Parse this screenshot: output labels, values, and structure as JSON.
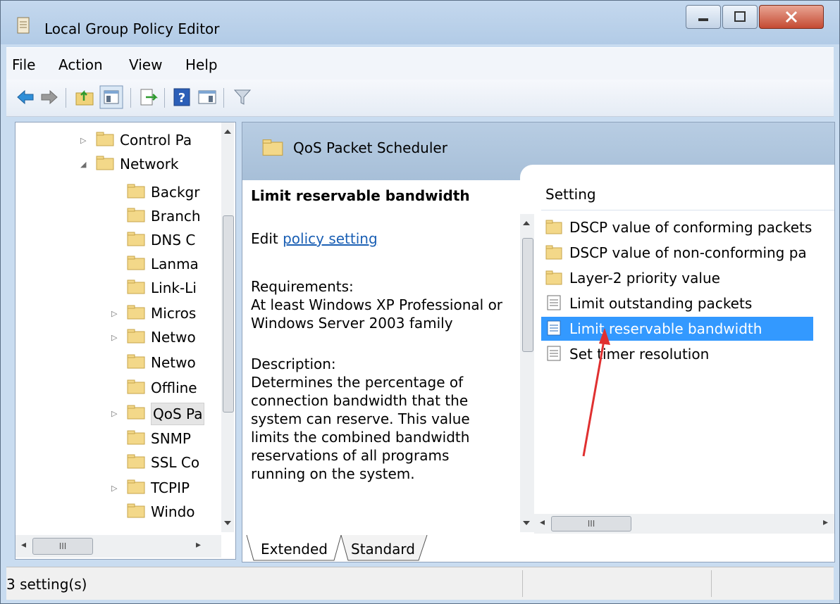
{
  "window": {
    "title": "Local Group Policy Editor"
  },
  "menu": [
    {
      "label": "File"
    },
    {
      "label": "Action"
    },
    {
      "label": "View"
    },
    {
      "label": "Help"
    }
  ],
  "toolbar": {
    "buttons": [
      "back-icon",
      "forward-icon",
      "up-folder-icon",
      "show-hide-console-tree-icon",
      "export-list-icon",
      "help-icon",
      "show-hide-action-pane-icon",
      "filter-icon"
    ]
  },
  "tree": {
    "items": [
      {
        "label": "Control Pa",
        "expander": "▷"
      },
      {
        "label": "Network",
        "expander": "◢"
      },
      {
        "label": "Backgr",
        "expander": ""
      },
      {
        "label": "Branch",
        "expander": ""
      },
      {
        "label": "DNS C",
        "expander": ""
      },
      {
        "label": "Lanma",
        "expander": ""
      },
      {
        "label": "Link-Li",
        "expander": ""
      },
      {
        "label": "Micros",
        "expander": "▷"
      },
      {
        "label": "Netwo",
        "expander": "▷"
      },
      {
        "label": "Netwo",
        "expander": ""
      },
      {
        "label": "Offline",
        "expander": ""
      },
      {
        "label": "QoS Pa",
        "expander": "▷"
      },
      {
        "label": "SNMP",
        "expander": ""
      },
      {
        "label": "SSL Co",
        "expander": ""
      },
      {
        "label": "TCPIP",
        "expander": "▷"
      },
      {
        "label": "Windo",
        "expander": ""
      }
    ],
    "scroll_h_thumb": "III"
  },
  "right": {
    "header_title": "QoS Packet Scheduler",
    "extended": {
      "selected_name": "Limit reservable bandwidth",
      "edit_prefix": "Edit ",
      "edit_link": "policy setting",
      "requirements_label": "Requirements:",
      "requirements_text": "At least Windows XP Professional or Windows Server 2003 family",
      "description_label": "Description:",
      "description_text": "Determines the percentage of connection bandwidth that the system can reserve. This value limits the combined bandwidth reservations of all programs running on the system."
    },
    "list": {
      "column": "Setting",
      "items": [
        {
          "label": "DSCP value of conforming packets",
          "type": "folder"
        },
        {
          "label": "DSCP value of non-conforming pa",
          "type": "folder"
        },
        {
          "label": "Layer-2 priority value",
          "type": "folder"
        },
        {
          "label": "Limit outstanding packets",
          "type": "setting"
        },
        {
          "label": "Limit reservable bandwidth",
          "type": "setting",
          "selected": true
        },
        {
          "label": "Set timer resolution",
          "type": "setting"
        }
      ],
      "scroll_h_thumb": "III"
    },
    "tabs": [
      {
        "label": "Extended"
      },
      {
        "label": "Standard"
      }
    ]
  },
  "status": {
    "text": "3 setting(s)"
  },
  "colors": {
    "selection": "#3399ff",
    "link": "#1a5fb4",
    "annotation_arrow": "#e03030"
  }
}
